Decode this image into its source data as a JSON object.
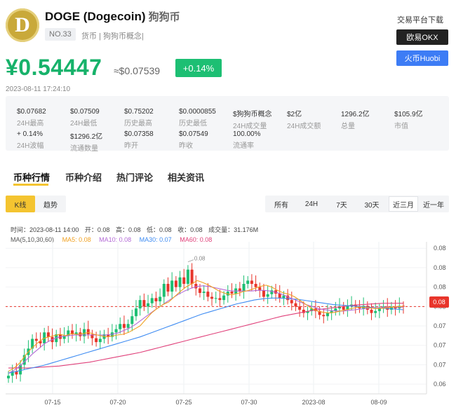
{
  "coin": {
    "logo_letter": "D",
    "name": "DOGE (Dogecoin)",
    "cn_name": "狗狗币",
    "rank": "NO.33",
    "tags": "货币 | 狗狗币概念|"
  },
  "exchange": {
    "title": "交易平台下载",
    "okx": "欧易OKX",
    "huobi": "火币Huobi"
  },
  "price": {
    "cny": "¥0.54447",
    "usd": "≈$0.07539",
    "change": "+0.14%",
    "time": "2023-08-11 17:24:10"
  },
  "stats": [
    {
      "value": "$0.07682",
      "label": "24H最高"
    },
    {
      "value": "$0.07509",
      "label": "24H最低"
    },
    {
      "value": "$0.75202",
      "label": "历史最高"
    },
    {
      "value": "$0.0000855",
      "label": "历史最低"
    },
    {
      "value": "$狗狗币概念",
      "label": "24H成交量"
    },
    {
      "value": "$2亿",
      "label": "24H成交额"
    },
    {
      "value": "1296.2亿",
      "label": "总量"
    },
    {
      "value": "$105.9亿",
      "label": "市值"
    },
    {
      "value": "+ 0.14%",
      "label": "24H波幅"
    },
    {
      "value": "$1296.2亿",
      "label": "流通数量"
    },
    {
      "value": "$0.07358",
      "label": "昨开"
    },
    {
      "value": "$0.07549",
      "label": "昨收"
    },
    {
      "value": "100.00%",
      "label": "流通率"
    }
  ],
  "tabs": [
    "币种行情",
    "币种介绍",
    "热门评论",
    "相关资讯"
  ],
  "chart_mode": {
    "kline": "K线",
    "trend": "趋势"
  },
  "ranges": [
    "所有",
    "24H",
    "7天",
    "30天",
    "近三月",
    "近一年"
  ],
  "active_range": "近三月",
  "ohlc_line": {
    "time": "时间：2023-08-11 14:00",
    "open": "开：0.08",
    "high": "高：0.08",
    "low": "低：0.08",
    "close": "收：0.08",
    "volume": "成交量：31.176M"
  },
  "ma_legend": {
    "label": "MA(5,10,30,60)",
    "ma5": "MA5: 0.08",
    "ma10": "MA10: 0.08",
    "ma30": "MA30: 0.07",
    "ma60": "MA60: 0.08"
  },
  "colors": {
    "up": "#1dbf73",
    "down": "#e8352b",
    "ma5": "#f0a020",
    "ma10": "#b36ad6",
    "ma30": "#3d8bf2",
    "ma60": "#e0407a",
    "accent": "#f4c430"
  },
  "chart_data": {
    "type": "candlestick",
    "x_ticks": [
      "07-15",
      "07-20",
      "07-25",
      "07-30",
      "2023-08",
      "08-09"
    ],
    "y_ticks": [
      "0.08",
      "0.08",
      "0.08",
      "0.08",
      "0.07",
      "0.07",
      "0.07",
      "0.06"
    ],
    "y_tick_values": [
      0.0845,
      0.0815,
      0.0785,
      0.0755,
      0.0725,
      0.0695,
      0.0665,
      0.0635
    ],
    "current_price_label": "0.08",
    "current_price": 0.0755,
    "high_marker": "0.08",
    "close_series": [
      0.0648,
      0.0655,
      0.065,
      0.0665,
      0.068,
      0.069,
      0.0705,
      0.0702,
      0.0698,
      0.0715,
      0.0708,
      0.07,
      0.0712,
      0.0705,
      0.071,
      0.0718,
      0.0712,
      0.0715,
      0.0709,
      0.072,
      0.0712,
      0.0706,
      0.07,
      0.0705,
      0.0712,
      0.0708,
      0.0715,
      0.072,
      0.0728,
      0.0722,
      0.0728,
      0.074,
      0.0752,
      0.0765,
      0.0755,
      0.076,
      0.0768,
      0.0763,
      0.077,
      0.079,
      0.0778,
      0.0795,
      0.0785,
      0.08,
      0.079,
      0.0812,
      0.079,
      0.0783,
      0.0776,
      0.0778,
      0.077,
      0.0767,
      0.0768,
      0.0765,
      0.0772,
      0.0778,
      0.0775,
      0.0783,
      0.0778,
      0.079,
      0.0795,
      0.079,
      0.0785,
      0.078,
      0.077,
      0.0774,
      0.078,
      0.0775,
      0.0768,
      0.0772,
      0.0765,
      0.076,
      0.0755,
      0.075,
      0.0745,
      0.0748,
      0.0752,
      0.0748,
      0.0742,
      0.074,
      0.0745,
      0.0748,
      0.0752,
      0.0755,
      0.075,
      0.0756,
      0.0758,
      0.0755,
      0.0752,
      0.0756,
      0.075,
      0.0745,
      0.0748,
      0.0752,
      0.0755,
      0.075,
      0.0755,
      0.0752,
      0.0756,
      0.0755
    ],
    "ma5": [
      0.0655,
      0.066,
      0.0668,
      0.068,
      0.069,
      0.0698,
      0.0705,
      0.0708,
      0.071,
      0.0712,
      0.071,
      0.0713,
      0.0712,
      0.0713,
      0.0715,
      0.0712,
      0.071,
      0.0708,
      0.0709,
      0.0711,
      0.0712,
      0.0715,
      0.072,
      0.0725,
      0.0735,
      0.0745,
      0.0752,
      0.0758,
      0.0762,
      0.077,
      0.0778,
      0.0785,
      0.079,
      0.0795,
      0.0792,
      0.0788,
      0.0783,
      0.0778,
      0.0775,
      0.0773,
      0.0775,
      0.0778,
      0.078,
      0.0783,
      0.0786,
      0.0788,
      0.0785,
      0.078,
      0.0776,
      0.0774,
      0.077,
      0.0764,
      0.0758,
      0.0752,
      0.0748,
      0.0746,
      0.0745,
      0.0746,
      0.0748,
      0.075,
      0.0752,
      0.0754,
      0.0754,
      0.0753,
      0.0752,
      0.0752,
      0.0753,
      0.0754,
      0.0755,
      0.0755
    ],
    "ma10": [
      0.0652,
      0.0657,
      0.0664,
      0.0673,
      0.0682,
      0.069,
      0.0698,
      0.0703,
      0.0707,
      0.0709,
      0.071,
      0.0711,
      0.0711,
      0.0711,
      0.0711,
      0.0711,
      0.0711,
      0.0712,
      0.0714,
      0.0718,
      0.0722,
      0.0728,
      0.0735,
      0.0742,
      0.0749,
      0.0755,
      0.0762,
      0.0768,
      0.0774,
      0.0779,
      0.0783,
      0.0786,
      0.0787,
      0.0786,
      0.0784,
      0.0782,
      0.078,
      0.0779,
      0.0779,
      0.0779,
      0.0779,
      0.078,
      0.078,
      0.0779,
      0.0777,
      0.0774,
      0.077,
      0.0766,
      0.0762,
      0.0758,
      0.0755,
      0.0752,
      0.075,
      0.0749,
      0.0748,
      0.0748,
      0.0749,
      0.075,
      0.0751,
      0.0752,
      0.0753,
      0.0753,
      0.0754,
      0.0754,
      0.0754,
      0.0754
    ],
    "ma30": [
      0.0652,
      0.0655,
      0.0658,
      0.0661,
      0.0664,
      0.0668,
      0.0672,
      0.0676,
      0.068,
      0.0684,
      0.0688,
      0.0692,
      0.0696,
      0.07,
      0.0704,
      0.0708,
      0.0713,
      0.0718,
      0.0723,
      0.0728,
      0.0733,
      0.0738,
      0.0743,
      0.0747,
      0.0751,
      0.0755,
      0.0759,
      0.0762,
      0.0765,
      0.0767,
      0.0768,
      0.0768,
      0.0767,
      0.0766,
      0.0764,
      0.0762,
      0.076,
      0.0758,
      0.0757,
      0.0756,
      0.0755,
      0.0754,
      0.0753,
      0.0752,
      0.0751,
      0.075
    ],
    "ma60": [
      0.066,
      0.066,
      0.066,
      0.0661,
      0.0662,
      0.0663,
      0.0665,
      0.0667,
      0.0669,
      0.0672,
      0.0675,
      0.0678,
      0.0681,
      0.0684,
      0.0688,
      0.0692,
      0.0696,
      0.07,
      0.0704,
      0.0708,
      0.0712,
      0.0716,
      0.072,
      0.0724,
      0.0728,
      0.0732,
      0.0736,
      0.074,
      0.0743,
      0.0746,
      0.0749,
      0.0751,
      0.0753,
      0.0755,
      0.0757,
      0.0758,
      0.0759,
      0.076,
      0.076,
      0.076
    ]
  }
}
